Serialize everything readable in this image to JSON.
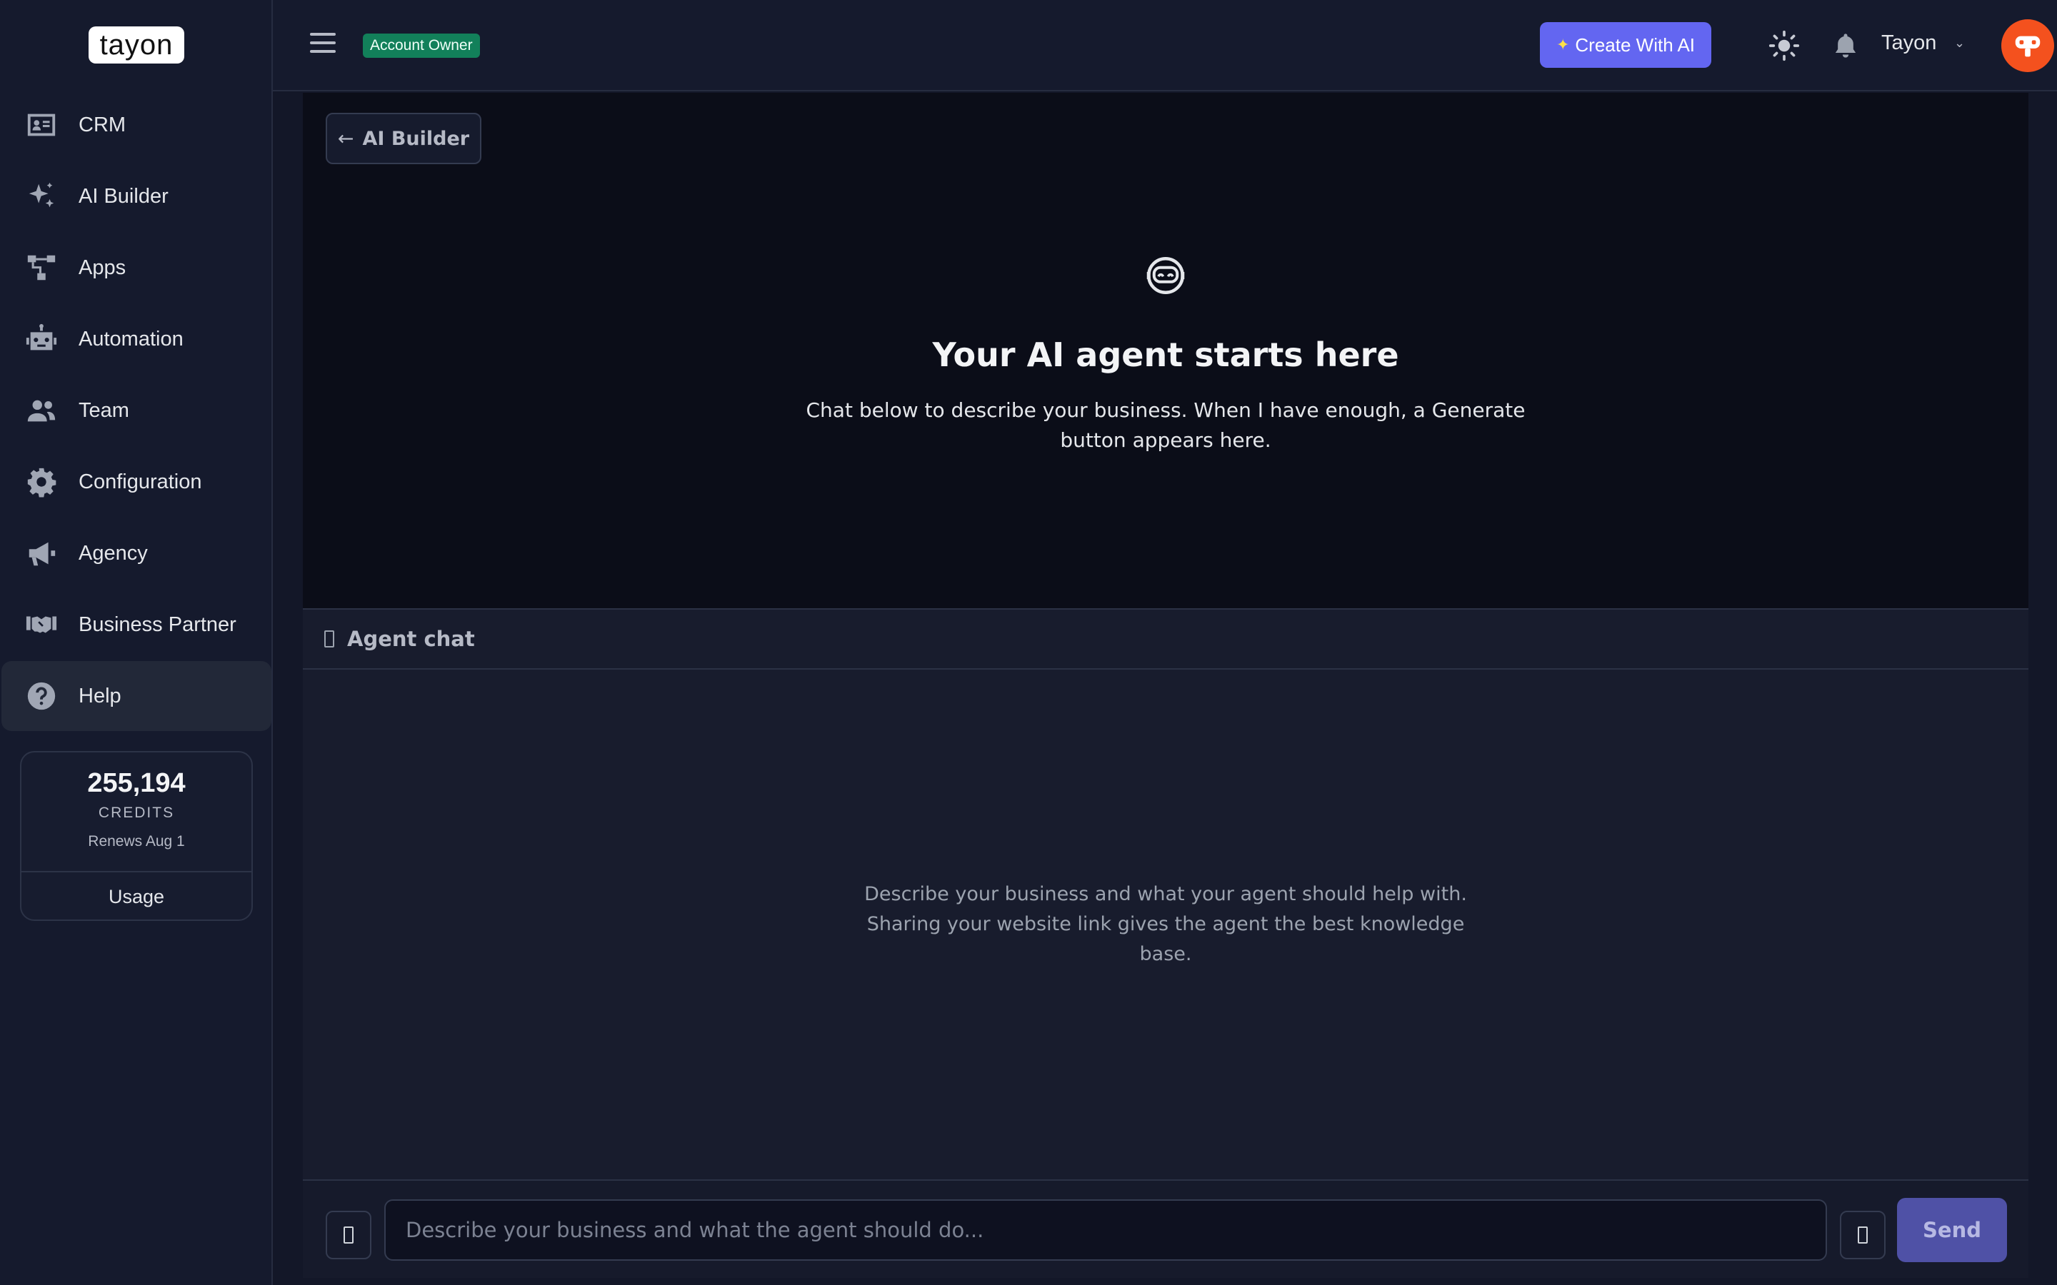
{
  "logo_text": "tayon",
  "sidebar": {
    "items": [
      {
        "label": "CRM",
        "icon": "id-card-icon"
      },
      {
        "label": "AI Builder",
        "icon": "sparkles-icon"
      },
      {
        "label": "Apps",
        "icon": "sitemap-icon"
      },
      {
        "label": "Automation",
        "icon": "robot-icon"
      },
      {
        "label": "Team",
        "icon": "users-icon"
      },
      {
        "label": "Configuration",
        "icon": "gear-icon"
      },
      {
        "label": "Agency",
        "icon": "megaphone-icon"
      },
      {
        "label": "Business Partner",
        "icon": "handshake-icon"
      },
      {
        "label": "Help",
        "icon": "question-circle-icon",
        "active": true
      }
    ]
  },
  "credits": {
    "amount": "255,194",
    "label": "CREDITS",
    "renews": "Renews Aug 1",
    "usage_label": "Usage"
  },
  "header": {
    "badge": "Account Owner",
    "create_button": "Create With AI",
    "user_name": "Tayon",
    "badge_color": "#12805a",
    "accent_color": "#6366f1",
    "avatar_color": "#f4511e"
  },
  "hero": {
    "back_label": "AI Builder",
    "title": "Your AI agent starts here",
    "subtitle": "Chat below to describe your business. When I have enough, a Generate button appears here."
  },
  "chat": {
    "header": "Agent chat",
    "empty_message": "Describe your business and what your agent should help with. Sharing your website link gives the agent the best knowledge base.",
    "input_placeholder": "Describe your business and what the agent should do...",
    "input_value": "",
    "send_label": "Send"
  }
}
